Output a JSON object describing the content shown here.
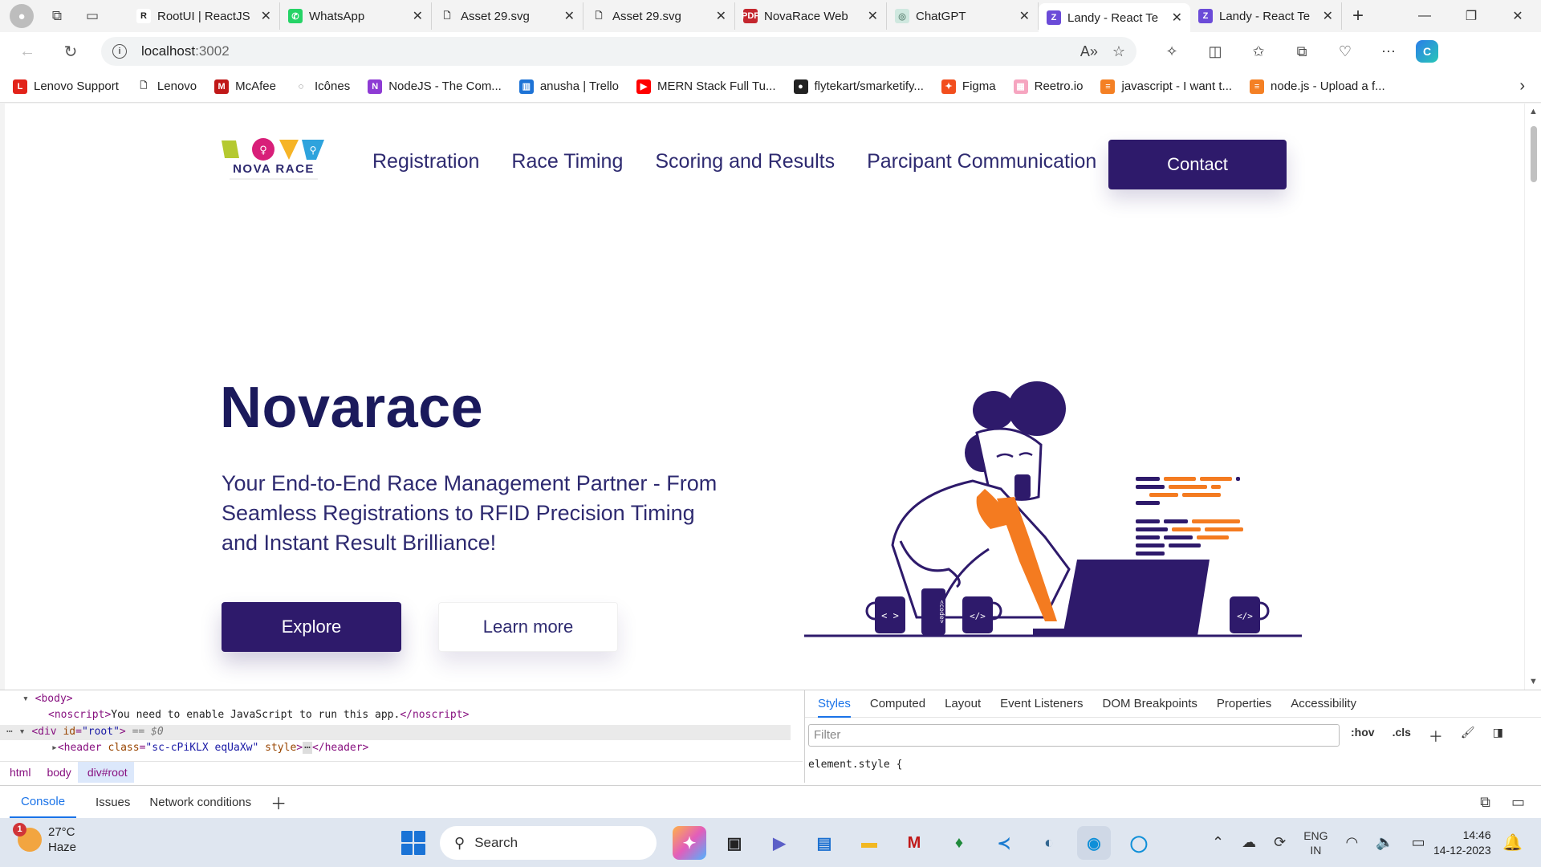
{
  "browser": {
    "tabs": [
      {
        "label": "RootUI | ReactJS",
        "favicon_text": "R",
        "favicon_color": "#ffffff",
        "favicon_fg": "#222222",
        "active": false
      },
      {
        "label": "WhatsApp",
        "favicon_text": "✆",
        "favicon_color": "#25d366",
        "favicon_fg": "#ffffff",
        "active": false
      },
      {
        "label": "Asset 29.svg",
        "favicon_text": "🗋",
        "favicon_color": "#f3f3f3",
        "favicon_fg": "#333333",
        "active": false
      },
      {
        "label": "Asset 29.svg",
        "favicon_text": "🗋",
        "favicon_color": "#f3f3f3",
        "favicon_fg": "#333333",
        "active": false
      },
      {
        "label": "NovaRace Web",
        "favicon_text": "PDF",
        "favicon_color": "#c4262e",
        "favicon_fg": "#ffffff",
        "active": false
      },
      {
        "label": "ChatGPT",
        "favicon_text": "◎",
        "favicon_color": "#cfe8df",
        "favicon_fg": "#6a8f80",
        "active": false
      },
      {
        "label": "Landy - React Te",
        "favicon_text": "Z",
        "favicon_color": "#6b4bd8",
        "favicon_fg": "#ffffff",
        "active": true
      },
      {
        "label": "Landy - React Te",
        "favicon_text": "Z",
        "favicon_color": "#6b4bd8",
        "favicon_fg": "#ffffff",
        "active": false
      }
    ],
    "new_tab_label": "+",
    "address": {
      "host": "localhost",
      "port": ":3002"
    },
    "bookmarks": [
      {
        "label": "Lenovo Support",
        "icon_text": "L",
        "icon_color": "#e2231a"
      },
      {
        "label": "Lenovo",
        "icon_text": "🗋",
        "icon_color": "#ffffff"
      },
      {
        "label": "McAfee",
        "icon_text": "M",
        "icon_color": "#c01818"
      },
      {
        "label": "Icônes",
        "icon_text": "◌",
        "icon_color": "#ffffff"
      },
      {
        "label": "NodeJS - The Com...",
        "icon_text": "N",
        "icon_color": "#8e3bd4"
      },
      {
        "label": "anusha | Trello",
        "icon_text": "▥",
        "icon_color": "#1e73d6"
      },
      {
        "label": "MERN Stack Full Tu...",
        "icon_text": "▶",
        "icon_color": "#ff0000"
      },
      {
        "label": "flytekart/smarketify...",
        "icon_text": "●",
        "icon_color": "#222222"
      },
      {
        "label": "Figma",
        "icon_text": "✦",
        "icon_color": "#f24e1e"
      },
      {
        "label": "Reetro.io",
        "icon_text": "▦",
        "icon_color": "#f6a5c0"
      },
      {
        "label": "javascript - I want t...",
        "icon_text": "≡",
        "icon_color": "#f48024"
      },
      {
        "label": "node.js - Upload a f...",
        "icon_text": "≡",
        "icon_color": "#f48024"
      }
    ]
  },
  "site": {
    "logo_text": "NOVA RACE",
    "nav": [
      "Registration",
      "Race Timing",
      "Scoring and Results",
      "Parcipant Communication"
    ],
    "contact_label": "Contact",
    "hero_title": "Novarace",
    "hero_subtitle": "Your End-to-End Race Management Partner - From Seamless Registrations to RFID Precision Timing and Instant Result Brilliance!",
    "explore_label": "Explore",
    "learn_more_label": "Learn more",
    "mug_labels": [
      "< >",
      "</>",
      "</>"
    ],
    "can_label": "<code>",
    "colors": {
      "primary": "#2e1a6b",
      "heading": "#1b1a5c",
      "accent": "#f47b20"
    }
  },
  "devtools": {
    "lines": [
      {
        "tag_open": "<body>"
      },
      {
        "text": "You need to enable JavaScript to run this app.",
        "tag": "noscript"
      },
      {
        "div_id": "root",
        "eq": "== $0"
      },
      {
        "header_class": "sc-cPiKLX eqUaXw",
        "ellipsis": "⋯"
      }
    ],
    "breadcrumbs": [
      "html",
      "body",
      "div#root"
    ],
    "style_tabs": [
      "Styles",
      "Computed",
      "Layout",
      "Event Listeners",
      "DOM Breakpoints",
      "Properties",
      "Accessibility"
    ],
    "filter_placeholder": "Filter",
    "filter_tools": [
      ":hov",
      ".cls"
    ],
    "element_style": "element.style {",
    "drawer_tabs": [
      "Console",
      "Issues",
      "Network conditions"
    ]
  },
  "taskbar": {
    "weather_temp": "27°C",
    "weather_desc": "Haze",
    "weather_badge": "1",
    "search_label": "Search",
    "lang_top": "ENG",
    "lang_bottom": "IN",
    "time": "14:46",
    "date": "14-12-2023"
  }
}
